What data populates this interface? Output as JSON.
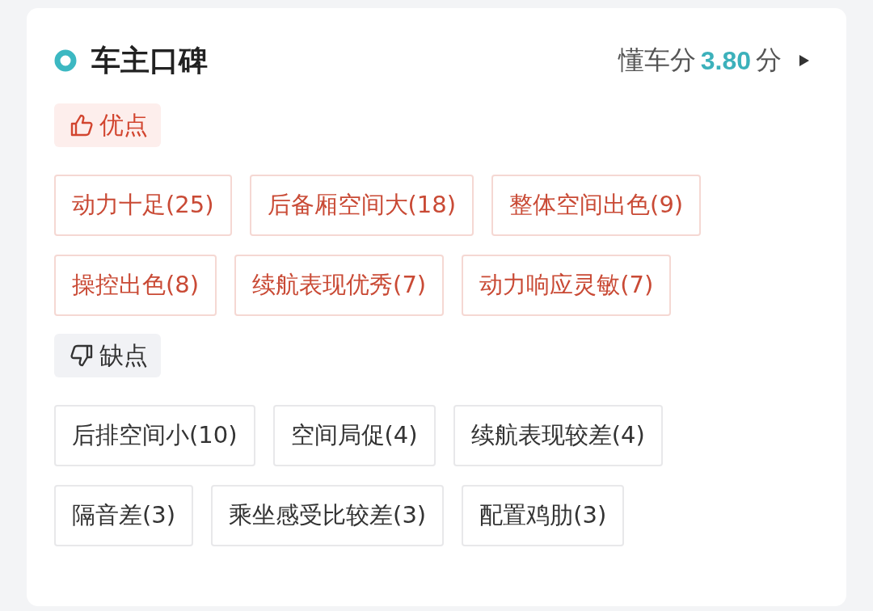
{
  "header": {
    "title": "车主口碑",
    "score_label": "懂车分",
    "score": "3.80",
    "score_unit": "分"
  },
  "sections": [
    {
      "kind": "pros",
      "label": "优点",
      "tags": [
        "动力十足(25)",
        "后备厢空间大(18)",
        "整体空间出色(9)",
        "操控出色(8)",
        "续航表现优秀(7)",
        "动力响应灵敏(7)"
      ]
    },
    {
      "kind": "cons",
      "label": "缺点",
      "tags": [
        "后排空间小(10)",
        "空间局促(4)",
        "续航表现较差(4)",
        "隔音差(3)",
        "乘坐感受比较差(3)",
        "配置鸡肋(3)"
      ]
    }
  ]
}
